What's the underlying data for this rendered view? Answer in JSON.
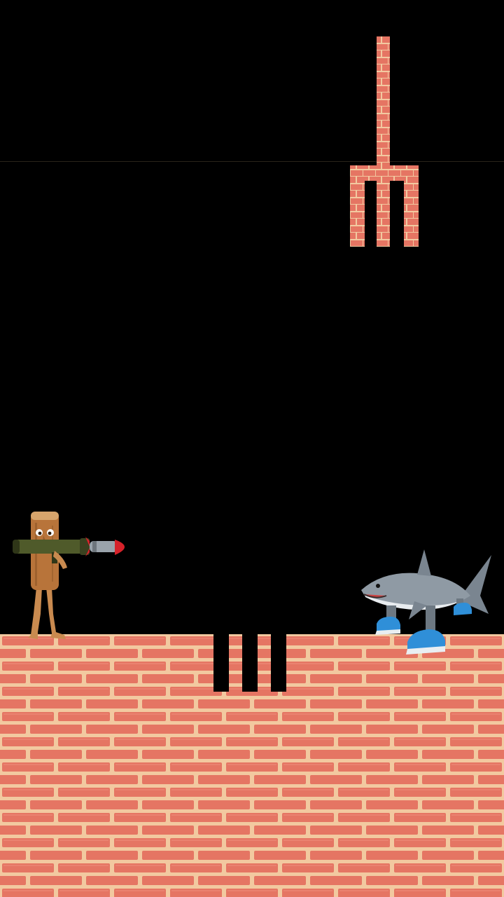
{
  "scene": {
    "type": "side-view platform game",
    "background_color": "#000000",
    "brick_color": "#e57563",
    "mortar_color": "#f2c9a0"
  },
  "hazards": {
    "trident_icon": "brick-trident-icon",
    "pit_slots": 3
  },
  "characters": {
    "player": {
      "icon": "wooden-log-with-rocket-launcher-icon"
    },
    "enemy": {
      "icon": "shark-wearing-sneakers-icon"
    }
  }
}
